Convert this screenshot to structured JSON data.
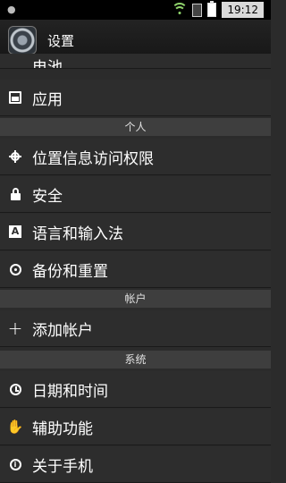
{
  "status_bar": {
    "time": "19:12",
    "icons": [
      "android-icon",
      "wifi-icon",
      "sim-icon",
      "battery-icon"
    ]
  },
  "action_bar": {
    "title": "设置",
    "icon": "settings-gear-icon"
  },
  "partial_item": {
    "label": "电池"
  },
  "items_top": [
    {
      "label": "应用",
      "icon": "apps-icon"
    }
  ],
  "sections": [
    {
      "header": "个人",
      "items": [
        {
          "label": "位置信息访问权限",
          "icon": "location-icon"
        },
        {
          "label": "安全",
          "icon": "lock-icon"
        },
        {
          "label": "语言和输入法",
          "icon": "language-icon",
          "glyph": "A"
        },
        {
          "label": "备份和重置",
          "icon": "backup-icon"
        }
      ]
    },
    {
      "header": "帐户",
      "items": [
        {
          "label": "添加帐户",
          "icon": "plus-icon",
          "glyph": "+"
        }
      ]
    },
    {
      "header": "系统",
      "items": [
        {
          "label": "日期和时间",
          "icon": "clock-icon"
        },
        {
          "label": "辅助功能",
          "icon": "hand-icon",
          "glyph": "✋"
        },
        {
          "label": "关于手机",
          "icon": "info-icon",
          "glyph": "i"
        }
      ]
    }
  ]
}
